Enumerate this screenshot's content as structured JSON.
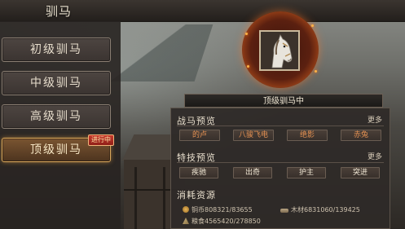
{
  "header": {
    "title": "驯马"
  },
  "menu": {
    "items": [
      {
        "label": "初级驯马"
      },
      {
        "label": "中级驯马"
      },
      {
        "label": "高级驯马"
      },
      {
        "label": "顶级驯马",
        "badge": "进行中",
        "active": true
      }
    ]
  },
  "portrait": {
    "status": "顶级驯马中",
    "icon": "white-horse-portrait"
  },
  "warhorse_preview": {
    "title": "战马预览",
    "more": "更多",
    "horses": [
      "的卢",
      "八骏飞电",
      "绝影",
      "赤兔"
    ]
  },
  "skill_preview": {
    "title": "特技预览",
    "more": "更多",
    "skills": [
      "疾驰",
      "出奇",
      "护主",
      "突进"
    ]
  },
  "resources": {
    "title": "消耗资源",
    "copper": "铜币808321/83655",
    "wood": "木材6831060/139425",
    "grain": "粮食4565420/278850"
  },
  "colors": {
    "active_border": "#d9a75b",
    "horse_name": "#e39052",
    "panel_bg": "#2e2a28"
  }
}
